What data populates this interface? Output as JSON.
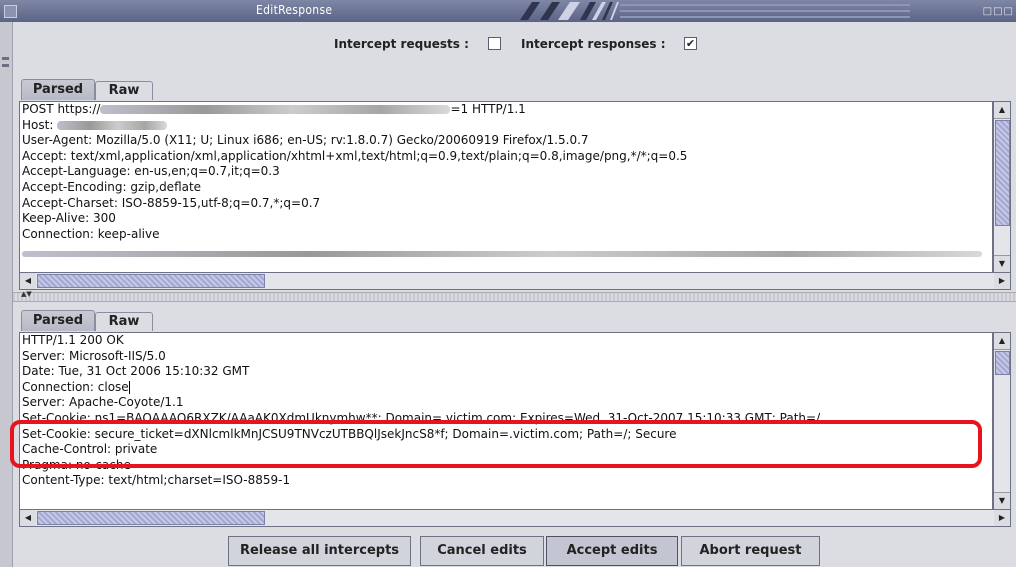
{
  "window": {
    "title": "EditResponse",
    "controls": "□□□"
  },
  "options": {
    "intercept_requests_label": "Intercept requests :",
    "intercept_requests_checked": false,
    "intercept_responses_label": "Intercept responses :",
    "intercept_responses_checked": true,
    "check_mark": "✔"
  },
  "request_panel": {
    "tabs": [
      "Parsed",
      "Raw"
    ],
    "active_tab": "Parsed",
    "first_line_prefix": "POST https://",
    "first_line_suffix": "=1 HTTP/1.1",
    "host_label": "Host:",
    "lines": [
      "User-Agent: Mozilla/5.0 (X11; U; Linux i686; en-US; rv:1.8.0.7) Gecko/20060919 Firefox/1.5.0.7",
      "Accept: text/xml,application/xml,application/xhtml+xml,text/html;q=0.9,text/plain;q=0.8,image/png,*/*;q=0.5",
      "Accept-Language: en-us,en;q=0.7,it;q=0.3",
      "Accept-Encoding: gzip,deflate",
      "Accept-Charset: ISO-8859-15,utf-8;q=0.7,*;q=0.7",
      "Keep-Alive: 300",
      "Connection: keep-alive"
    ]
  },
  "response_panel": {
    "tabs": [
      "Parsed",
      "Raw"
    ],
    "active_tab": "Parsed",
    "lines_before_cursor": [
      "HTTP/1.1 200 OK",
      "Server: Microsoft-IIS/5.0",
      "Date: Tue, 31 Oct 2006 15:10:32 GMT"
    ],
    "cursor_line": "Connection: close",
    "lines_after_cursor": [
      "Server: Apache-Coyote/1.1",
      "Set-Cookie: ns1=BAQAAAQ6RXZK/AAaAK0XdmUknymhw**; Domain=.victim.com; Expires=Wed, 31-Oct-2007 15:10:33 GMT; Path=/",
      "Set-Cookie: secure_ticket=dXNlcmlkMnJCSU9TNVczUTBBQlJsekJncS8*f; Domain=.victim.com; Path=/; Secure",
      "Cache-Control: private",
      "Pragma: no-cache",
      "Content-Type: text/html;charset=ISO-8859-1"
    ]
  },
  "scroll": {
    "up": "▲",
    "down": "▼",
    "left": "◀",
    "right": "▶",
    "split_arrows": "▲▼"
  },
  "buttons": {
    "release": "Release all intercepts",
    "cancel": "Cancel edits",
    "accept": "Accept edits",
    "abort": "Abort request"
  },
  "colors": {
    "highlight": "#e8131d",
    "thumb": "#a4a8cf",
    "title_bar": "#5c6486"
  }
}
